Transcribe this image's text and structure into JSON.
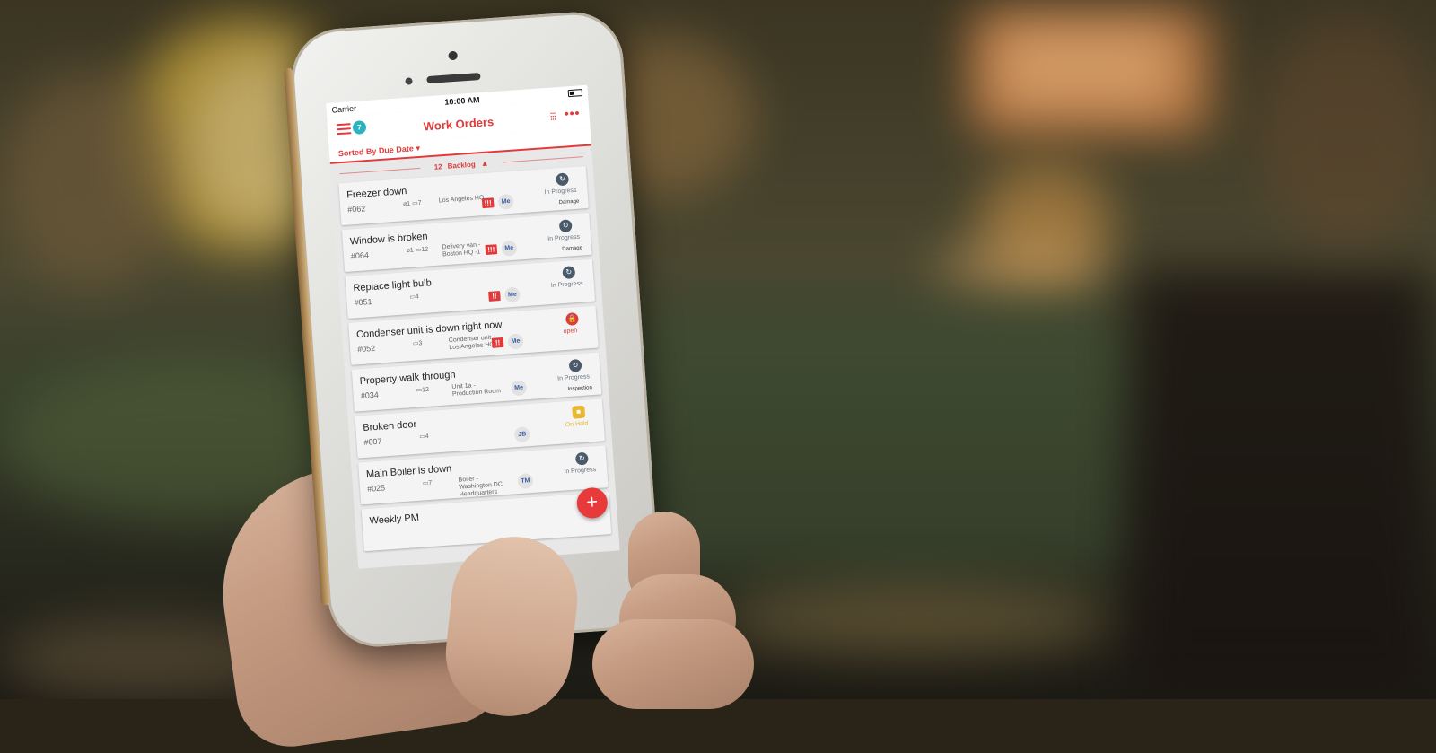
{
  "status_bar": {
    "carrier": "Carrier",
    "time": "10:00 AM"
  },
  "header": {
    "title": "Work Orders",
    "notification_count": "7",
    "more_label": "•••"
  },
  "sort": {
    "label": "Sorted By Due Date",
    "caret": "▼"
  },
  "section": {
    "count": "12",
    "label": "Backlog",
    "caret": "▲"
  },
  "colors": {
    "accent": "#e03a3a",
    "badge": "#2bb3c0",
    "status_in_progress": "#4a5a6a",
    "status_open": "#e03a3a",
    "status_on_hold": "#e8b830"
  },
  "work_orders": [
    {
      "title": "Freezer down",
      "id": "#062",
      "attachments": "1",
      "comments": "7",
      "location": "Los Angeles HQ",
      "priority": "!!!",
      "assignee": "Me",
      "status": "In Progress",
      "tag": "Damage",
      "status_icon": "refresh-icon"
    },
    {
      "title": "Window is broken",
      "id": "#064",
      "attachments": "1",
      "comments": "12",
      "location": "Delivery van - Boston HQ -1",
      "priority": "!!!",
      "assignee": "Me",
      "status": "In Progress",
      "tag": "Damage",
      "status_icon": "refresh-icon"
    },
    {
      "title": "Replace light bulb",
      "id": "#051",
      "attachments": "",
      "comments": "4",
      "location": "",
      "priority": "!!",
      "assignee": "Me",
      "status": "In Progress",
      "tag": "",
      "status_icon": "refresh-icon"
    },
    {
      "title": "Condenser unit is down right now",
      "id": "#052",
      "attachments": "",
      "comments": "3",
      "location": "Condenser unit - Los Angeles HQ",
      "priority": "!!",
      "assignee": "Me",
      "status": "open",
      "tag": "",
      "status_icon": "lock-icon"
    },
    {
      "title": "Property walk through",
      "id": "#034",
      "attachments": "",
      "comments": "12",
      "location": "Unit 1a - Production Room",
      "priority": "",
      "assignee": "Me",
      "status": "In Progress",
      "tag": "Inspection",
      "status_icon": "refresh-icon"
    },
    {
      "title": "Broken door",
      "id": "#007",
      "attachments": "",
      "comments": "4",
      "location": "",
      "priority": "",
      "assignee": "JB",
      "status": "On Hold",
      "tag": "",
      "status_icon": "pause-icon"
    },
    {
      "title": "Main Boiler is down",
      "id": "#025",
      "attachments": "",
      "comments": "7",
      "location": "Boiler - Washington DC Headquarters",
      "priority": "",
      "assignee": "TM",
      "status": "In Progress",
      "tag": "",
      "status_icon": "refresh-icon"
    },
    {
      "title": "Weekly PM",
      "id": "",
      "attachments": "",
      "comments": "",
      "location": "",
      "priority": "",
      "assignee": "",
      "status": "",
      "tag": "",
      "status_icon": ""
    }
  ],
  "fab": {
    "label": "+"
  }
}
